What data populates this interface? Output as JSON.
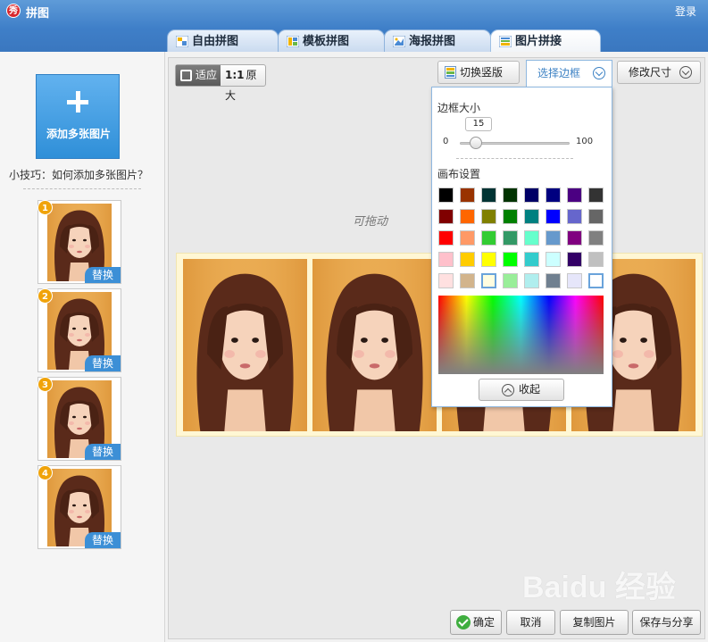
{
  "app": {
    "title": "拼图",
    "logo_text": "秀",
    "login": "登录"
  },
  "tabs": [
    {
      "label": "自由拼图",
      "icon": "free-collage-icon"
    },
    {
      "label": "模板拼图",
      "icon": "template-collage-icon"
    },
    {
      "label": "海报拼图",
      "icon": "poster-collage-icon"
    },
    {
      "label": "图片拼接",
      "icon": "image-stitch-icon",
      "active": true
    }
  ],
  "sidebar": {
    "add_label": "添加多张图片",
    "tip": "小技巧：如何添加多张图片？",
    "thumbnails": [
      {
        "num": "1",
        "replace": "替换"
      },
      {
        "num": "2",
        "replace": "替换"
      },
      {
        "num": "3",
        "replace": "替换"
      },
      {
        "num": "4",
        "replace": "替换"
      }
    ]
  },
  "toolbar": {
    "fit": "适应",
    "original_prefix": "1:1",
    "original": "原大",
    "switch_layout": "切换竖版",
    "select_border": "选择边框",
    "resize": "修改尺寸"
  },
  "canvas": {
    "watermark": "可拖动"
  },
  "border_popup": {
    "size_title": "边框大小",
    "size_value": "15",
    "size_value_num": 15,
    "min": "0",
    "max": "100",
    "canvas_title": "画布设置",
    "colors": [
      "#000000",
      "#993300",
      "#003333",
      "#003300",
      "#000066",
      "#000080",
      "#4b0082",
      "#333333",
      "#800000",
      "#ff6600",
      "#808000",
      "#008000",
      "#008080",
      "#0000ff",
      "#6666cc",
      "#666666",
      "#ff0000",
      "#ff9966",
      "#33cc33",
      "#339966",
      "#66ffcc",
      "#6699cc",
      "#800080",
      "#808080",
      "#ffc0cb",
      "#ffcc00",
      "#ffff00",
      "#00ff00",
      "#33cccc",
      "#ccffff",
      "#330066",
      "#c0c0c0",
      "#ffe0e0",
      "#d2b48c",
      "#fffde0",
      "#99ee99",
      "#b0eeee",
      "#708090",
      "#e6e6fa",
      "#ffffff"
    ],
    "collapse": "收起"
  },
  "bottom": {
    "ok": "确定",
    "cancel": "取消",
    "copy": "复制图片",
    "save_share": "保存与分享"
  },
  "watermark_brand": "Baidu 经验"
}
